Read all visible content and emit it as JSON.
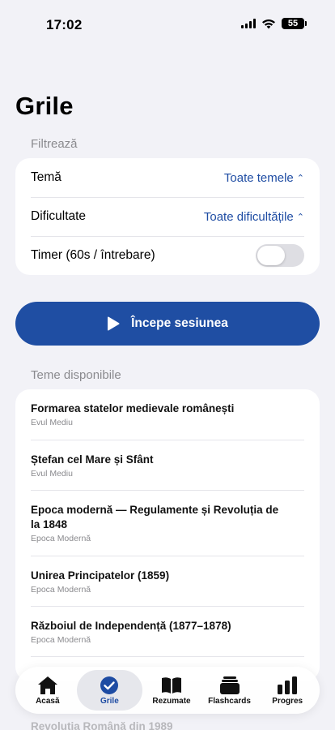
{
  "status": {
    "time": "17:02",
    "battery": "55"
  },
  "title": "Grile",
  "filter": {
    "label": "Filtrează",
    "topic_label": "Temă",
    "topic_value": "Toate temele",
    "difficulty_label": "Dificultate",
    "difficulty_value": "Toate dificultățile",
    "timer_label": "Timer (60s / întrebare)",
    "timer_on": false
  },
  "start_button": "Începe sesiunea",
  "topics": {
    "label": "Teme disponibile",
    "items": [
      {
        "title": "Formarea statelor medievale românești",
        "period": "Evul Mediu"
      },
      {
        "title": "Ștefan cel Mare și Sfânt",
        "period": "Evul Mediu"
      },
      {
        "title": "Epoca modernă — Regulamente și Revoluția de la 1848",
        "period": "Epoca Modernă"
      },
      {
        "title": "Unirea Principatelor (1859)",
        "period": "Epoca Modernă"
      },
      {
        "title": "Războiul de Independență (1877–1878)",
        "period": "Epoca Modernă"
      }
    ],
    "partial_item": "Revoluția Română din 1989"
  },
  "tabs": [
    {
      "label": "Acasă",
      "icon": "home-icon",
      "active": false
    },
    {
      "label": "Grile",
      "icon": "checkmark-circle-icon",
      "active": true
    },
    {
      "label": "Rezumate",
      "icon": "book-icon",
      "active": false
    },
    {
      "label": "Flashcards",
      "icon": "cards-icon",
      "active": false
    },
    {
      "label": "Progres",
      "icon": "bar-chart-icon",
      "active": false
    }
  ],
  "colors": {
    "accent": "#1f4ea3",
    "background": "#f2f2f7"
  }
}
